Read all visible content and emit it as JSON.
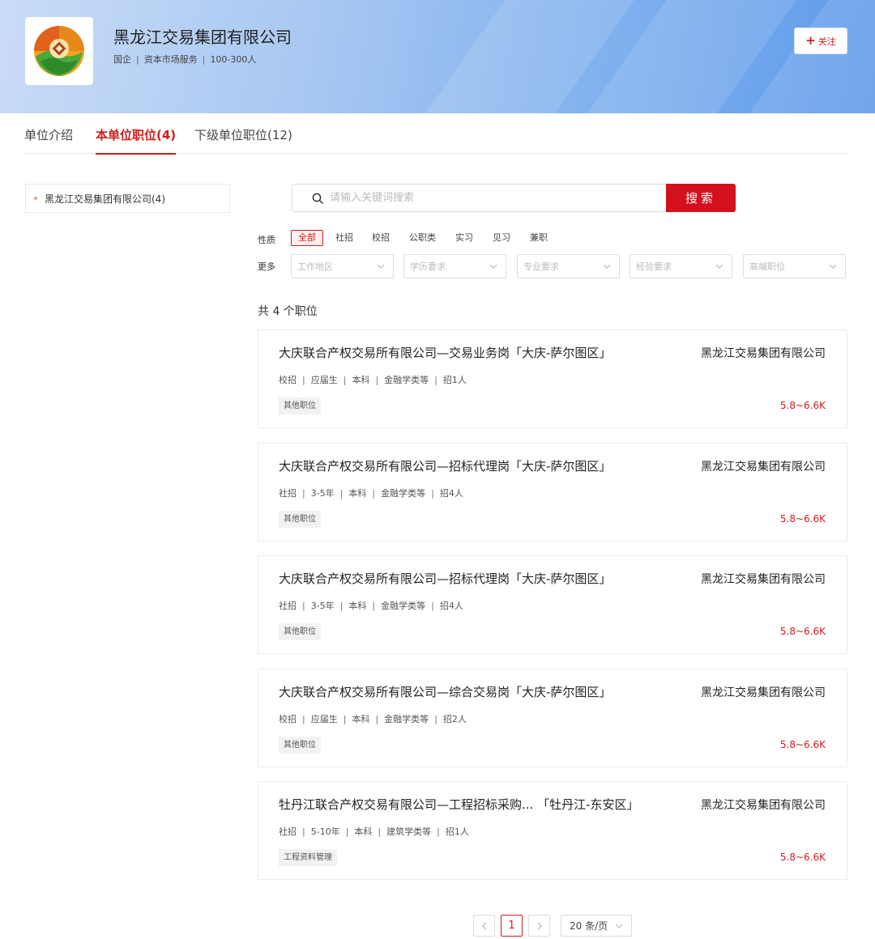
{
  "company": {
    "name": "黑龙江交易集团有限公司",
    "meta": [
      "国企",
      "资本市场服务",
      "100-300人"
    ],
    "follow_label": "关注",
    "colors": {
      "banner_start": "#c9dcf7",
      "banner_end": "#5e9aea",
      "accent": "#d21c1c"
    }
  },
  "tabs": [
    {
      "label": "单位介绍",
      "active": false
    },
    {
      "label": "本单位职位(4)",
      "active": true
    },
    {
      "label": "下级单位职位(12)",
      "active": false
    }
  ],
  "unit_filter": {
    "label": "黑龙江交易集团有限公司(4)"
  },
  "search": {
    "placeholder": "请输入关键词搜索",
    "value": "",
    "button_label": "搜索"
  },
  "filters": {
    "nature_label": "性质",
    "nature_options": [
      {
        "label": "全部",
        "active": true
      },
      {
        "label": "社招",
        "active": false
      },
      {
        "label": "校招",
        "active": false
      },
      {
        "label": "公职类",
        "active": false
      },
      {
        "label": "实习",
        "active": false
      },
      {
        "label": "见习",
        "active": false
      },
      {
        "label": "兼职",
        "active": false
      }
    ],
    "more_label": "更多",
    "dropdowns": [
      "工作地区",
      "学历要求",
      "专业要求",
      "经验要求",
      "高端职位"
    ]
  },
  "total_count": "共 4 个职位",
  "jobs": [
    {
      "title": "大庆联合产权交易所有限公司—交易业务岗「大庆-萨尔图区」",
      "company": "黑龙江交易集团有限公司",
      "meta": [
        "校招",
        "应届生",
        "本科",
        "金融学类等",
        "招1人"
      ],
      "tag": "其他职位",
      "salary": "5.8~6.6K"
    },
    {
      "title": "大庆联合产权交易所有限公司—招标代理岗「大庆-萨尔图区」",
      "company": "黑龙江交易集团有限公司",
      "meta": [
        "社招",
        "3-5年",
        "本科",
        "金融学类等",
        "招4人"
      ],
      "tag": "其他职位",
      "salary": "5.8~6.6K"
    },
    {
      "title": "大庆联合产权交易所有限公司—招标代理岗「大庆-萨尔图区」",
      "company": "黑龙江交易集团有限公司",
      "meta": [
        "社招",
        "3-5年",
        "本科",
        "金融学类等",
        "招4人"
      ],
      "tag": "其他职位",
      "salary": "5.8~6.6K"
    },
    {
      "title": "大庆联合产权交易所有限公司—综合交易岗「大庆-萨尔图区」",
      "company": "黑龙江交易集团有限公司",
      "meta": [
        "校招",
        "应届生",
        "本科",
        "金融学类等",
        "招2人"
      ],
      "tag": "其他职位",
      "salary": "5.8~6.6K"
    },
    {
      "title": "牡丹江联合产权交易有限公司—工程招标采购... 「牡丹江-东安区」",
      "company": "黑龙江交易集团有限公司",
      "meta": [
        "社招",
        "5-10年",
        "本科",
        "建筑学类等",
        "招1人"
      ],
      "tag": "工程资料管理",
      "salary": "5.8~6.6K"
    }
  ],
  "pagination": {
    "prev_icon": "chevron-left-icon",
    "current_page": "1",
    "next_icon": "chevron-right-icon",
    "page_size": "20 条/页"
  }
}
